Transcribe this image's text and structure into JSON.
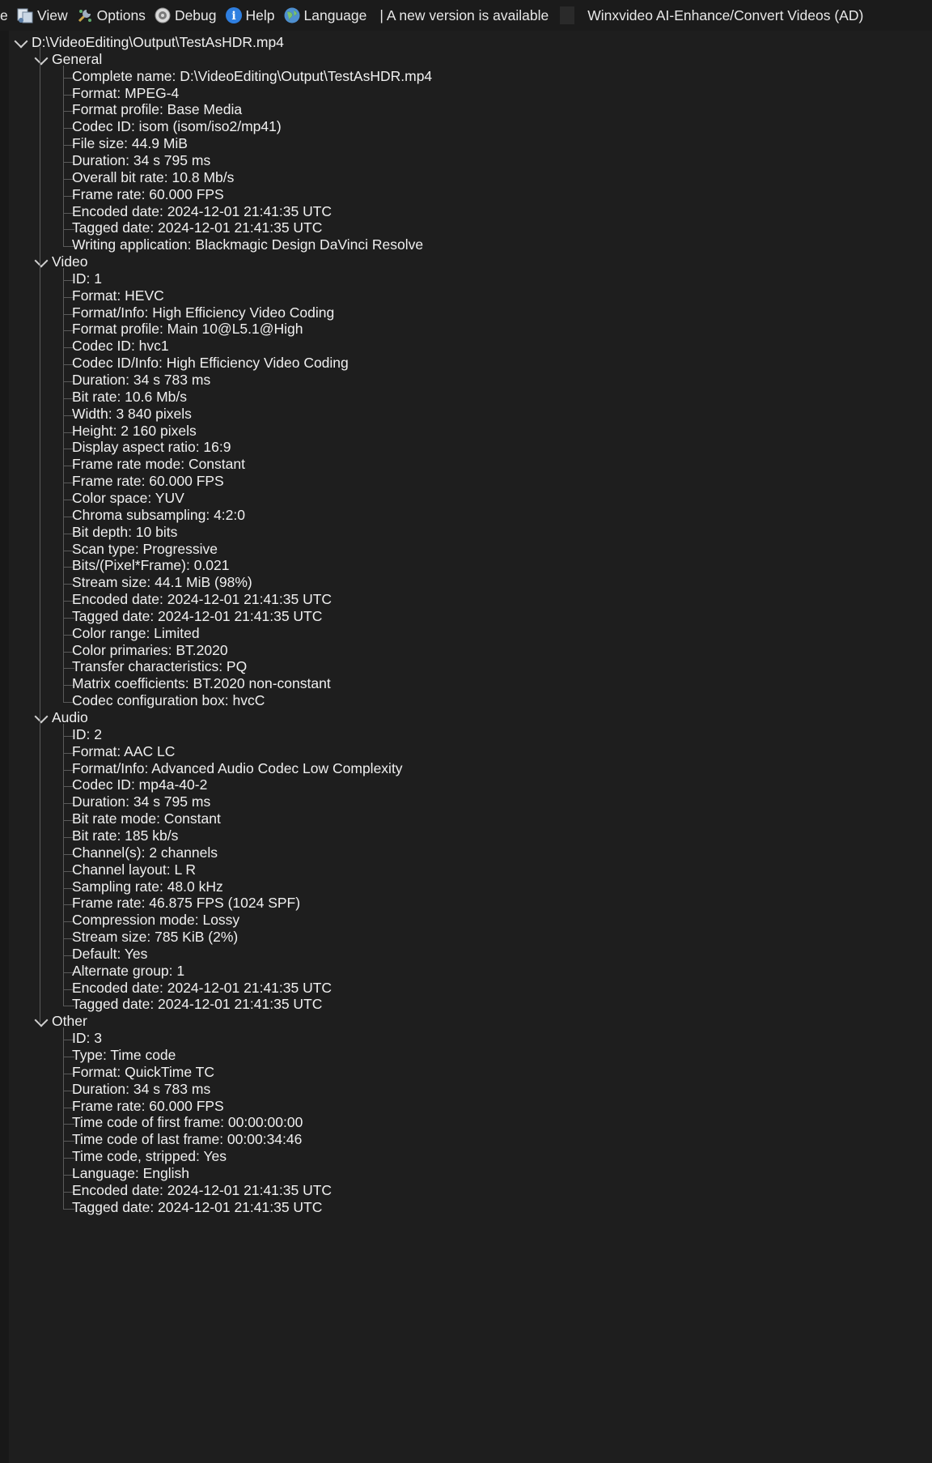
{
  "toolbar": {
    "left_cut": "e",
    "items": [
      {
        "id": "view",
        "label": "View",
        "icon": "view-icon"
      },
      {
        "id": "options",
        "label": "Options",
        "icon": "options-icon"
      },
      {
        "id": "debug",
        "label": "Debug",
        "icon": "debug-icon"
      },
      {
        "id": "help",
        "label": "Help",
        "icon": "help-icon"
      },
      {
        "id": "language",
        "label": "Language",
        "icon": "language-icon"
      }
    ],
    "new_version": "| A new version is available",
    "ad": "Winxvideo AI-Enhance/Convert Videos (AD)"
  },
  "tree": {
    "root": "D:\\VideoEditing\\Output\\TestAsHDR.mp4",
    "sections": [
      {
        "name": "General",
        "items": [
          "Complete name: D:\\VideoEditing\\Output\\TestAsHDR.mp4",
          "Format: MPEG-4",
          "Format profile: Base Media",
          "Codec ID: isom (isom/iso2/mp41)",
          "File size: 44.9 MiB",
          "Duration: 34 s 795 ms",
          "Overall bit rate: 10.8 Mb/s",
          "Frame rate: 60.000 FPS",
          "Encoded date: 2024-12-01 21:41:35 UTC",
          "Tagged date: 2024-12-01 21:41:35 UTC",
          "Writing application: Blackmagic Design DaVinci Resolve"
        ]
      },
      {
        "name": "Video",
        "items": [
          "ID: 1",
          "Format: HEVC",
          "Format/Info: High Efficiency Video Coding",
          "Format profile: Main 10@L5.1@High",
          "Codec ID: hvc1",
          "Codec ID/Info: High Efficiency Video Coding",
          "Duration: 34 s 783 ms",
          "Bit rate: 10.6 Mb/s",
          "Width: 3 840 pixels",
          "Height: 2 160 pixels",
          "Display aspect ratio: 16:9",
          "Frame rate mode: Constant",
          "Frame rate: 60.000 FPS",
          "Color space: YUV",
          "Chroma subsampling: 4:2:0",
          "Bit depth: 10 bits",
          "Scan type: Progressive",
          "Bits/(Pixel*Frame): 0.021",
          "Stream size: 44.1 MiB (98%)",
          "Encoded date: 2024-12-01 21:41:35 UTC",
          "Tagged date: 2024-12-01 21:41:35 UTC",
          "Color range: Limited",
          "Color primaries: BT.2020",
          "Transfer characteristics: PQ",
          "Matrix coefficients: BT.2020 non-constant",
          "Codec configuration box: hvcC"
        ]
      },
      {
        "name": "Audio",
        "items": [
          "ID: 2",
          "Format: AAC LC",
          "Format/Info: Advanced Audio Codec Low Complexity",
          "Codec ID: mp4a-40-2",
          "Duration: 34 s 795 ms",
          "Bit rate mode: Constant",
          "Bit rate: 185 kb/s",
          "Channel(s): 2 channels",
          "Channel layout: L R",
          "Sampling rate: 48.0 kHz",
          "Frame rate: 46.875 FPS (1024 SPF)",
          "Compression mode: Lossy",
          "Stream size: 785 KiB (2%)",
          "Default: Yes",
          "Alternate group: 1",
          "Encoded date: 2024-12-01 21:41:35 UTC",
          "Tagged date: 2024-12-01 21:41:35 UTC"
        ]
      },
      {
        "name": "Other",
        "items": [
          "ID: 3",
          "Type: Time code",
          "Format: QuickTime TC",
          "Duration: 34 s 783 ms",
          "Frame rate: 60.000 FPS",
          "Time code of first frame: 00:00:00:00",
          "Time code of last frame: 00:00:34:46",
          "Time code, stripped: Yes",
          "Language: English",
          "Encoded date: 2024-12-01 21:41:35 UTC",
          "Tagged date: 2024-12-01 21:41:35 UTC"
        ]
      }
    ]
  }
}
